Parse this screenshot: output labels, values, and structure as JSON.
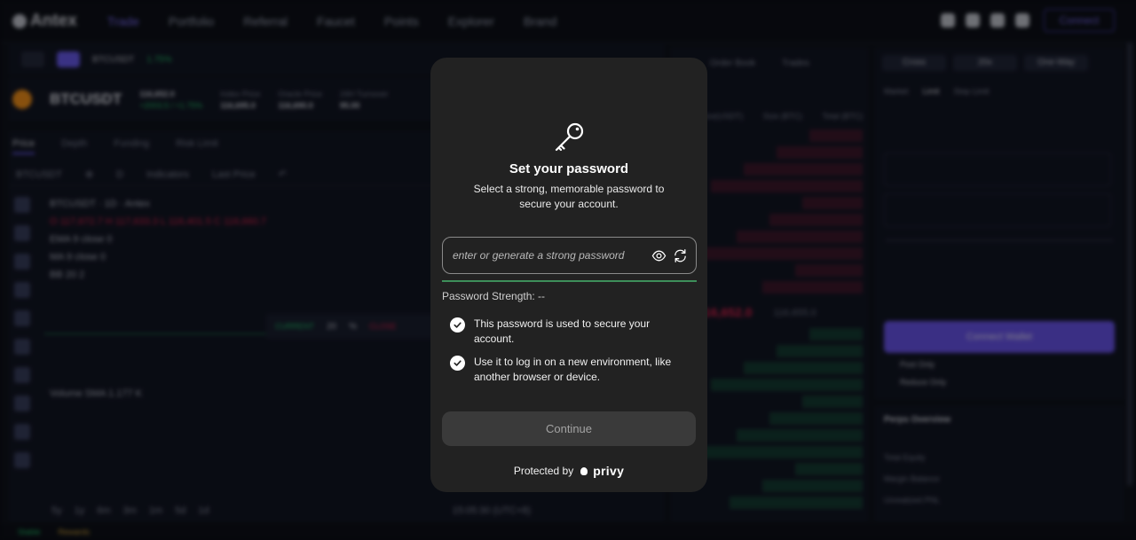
{
  "background_app": {
    "logo": "Antex",
    "nav": [
      "Trade",
      "Portfolio",
      "Referral",
      "Faucet",
      "Points",
      "Explorer",
      "Brand"
    ],
    "connect_label": "Connect",
    "pair": "BTCUSDT",
    "pair_change": "1.75%",
    "price": "116,652.0",
    "price_change": "+2003.5 / +1.75%",
    "stats": [
      {
        "label": "Index Price",
        "value": "116,695.0"
      },
      {
        "label": "Oracle Price",
        "value": "116,690.0"
      },
      {
        "label": "24H Turnover",
        "value": "95.00"
      }
    ],
    "chart_tabs": [
      "Price",
      "Depth",
      "Funding",
      "Risk Limit"
    ],
    "toolbar": [
      "BTCUSDT",
      "Indicators",
      "Last Price"
    ],
    "chart_legend": [
      "BTCUSDT · 1D · Antex",
      "O 117,672.7  H 117,633.3  L 116,401.5  C 116,660.7",
      "EMA 9 close 0",
      "MA 9 close 0",
      "BB 20 2"
    ],
    "price_box": [
      "CURRENT",
      "20",
      "%",
      "CLOSE"
    ],
    "volume_label": "Volume SMA 1.177 K",
    "timeframes": [
      "5y",
      "1y",
      "6m",
      "3m",
      "1m",
      "5d",
      "1d"
    ],
    "time": "15:05:30 (UTC+8)",
    "footer": [
      "Stable",
      "Rewards"
    ],
    "orderbook_tabs": [
      "Order Book",
      "Trades"
    ],
    "orderbook_headers": [
      "Price(USDT)",
      "Size (BTC)",
      "Total (BTC)"
    ],
    "mid_price": "116,652.0",
    "mark_price": "116,655.0",
    "trade_tabs": [
      "Cross",
      "20x",
      "One-Way"
    ],
    "order_types": [
      "Market",
      "Limit",
      "Stop Limit"
    ],
    "connect_wallet": "Connect Wallet",
    "post_only": "Post Only",
    "reduce_only": "Reduce Only",
    "perps_title": "Perps Overview",
    "perps_rows": [
      "Total Equity",
      "Margin Balance",
      "Unrealized PNL"
    ]
  },
  "modal": {
    "icon": "key-icon",
    "title": "Set your password",
    "subtitle": "Select a strong, memorable password to secure your account.",
    "password_placeholder": "enter or generate a strong password",
    "show_icon": "eye-icon",
    "generate_icon": "refresh-icon",
    "strength_label": "Password Strength: --",
    "strength_fill": 1.0,
    "checks": [
      "This password is used to secure your account.",
      "Use it to log in on a new environment, like another browser or device."
    ],
    "continue_label": "Continue",
    "protected_by": "Protected by",
    "brand": "privy",
    "colors": {
      "modal_bg": "#222222",
      "strength_bar": "#3d8f5a",
      "continue_bg": "#3a3a3a"
    }
  }
}
